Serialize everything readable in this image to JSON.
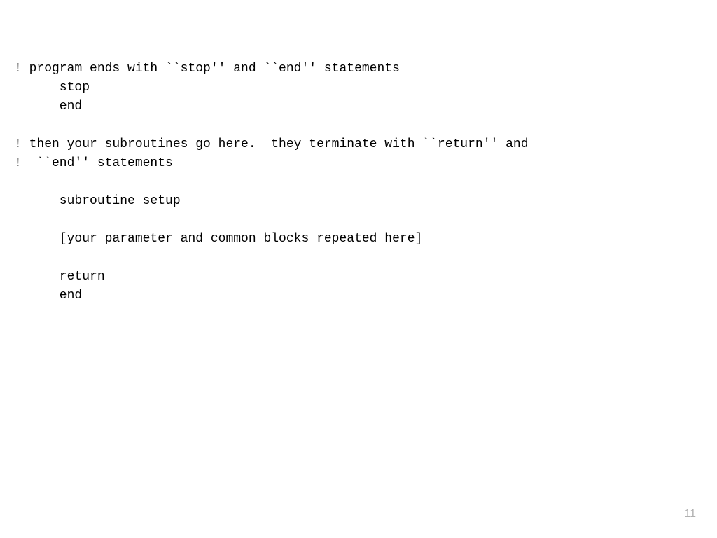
{
  "lines": {
    "l1": "! program ends with ``stop'' and ``end'' statements",
    "l2": "      stop",
    "l3": "      end",
    "l4": "! then your subroutines go here.  they terminate with ``return'' and",
    "l5": "!  ``end'' statements",
    "l6": "      subroutine setup",
    "l7": "      [your parameter and common blocks repeated here]",
    "l8": "      return",
    "l9": "      end"
  },
  "page_number": "11"
}
